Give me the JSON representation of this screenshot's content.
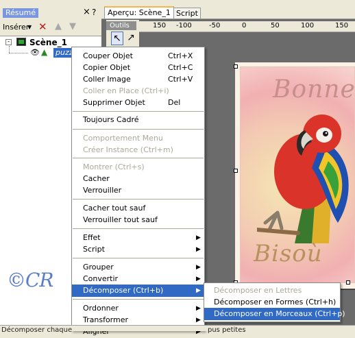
{
  "left_panel": {
    "title": "Résumé",
    "close_glyph": "×",
    "help_glyph": "?",
    "toolbar": {
      "insert_label": "Insérer",
      "insert_caret": "▼",
      "delete_icon": "✕",
      "up_icon": "▲",
      "down_icon": "▼"
    },
    "tree": {
      "expander": "-",
      "scene_label": "Scène_1",
      "object_label": "puzzle",
      "eye_icon": "👁",
      "shape_icon": "▲"
    },
    "watermark": "©CR"
  },
  "tabs": [
    {
      "label": "Aperçu: Scène_1",
      "active": true
    },
    {
      "label": "Script",
      "active": false
    }
  ],
  "outils": {
    "title": "Outils",
    "arrow_tool_glyph": "↖",
    "node_tool_glyph": "↗"
  },
  "ruler": {
    "ticks": [
      "150",
      "-100",
      "-50",
      "0",
      "50",
      "100",
      "150"
    ]
  },
  "canvas": {
    "text_top": "Bonne",
    "text_bottom": "Bisoù"
  },
  "context_menu": {
    "items": [
      {
        "label": "Couper Objet",
        "shortcut": "Ctrl+X",
        "disabled": false
      },
      {
        "label": "Copier Objet",
        "shortcut": "Ctrl+C",
        "disabled": false
      },
      {
        "label": "Coller Image",
        "shortcut": "Ctrl+V",
        "disabled": false
      },
      {
        "label": "Coller en Place (Ctrl+i)",
        "shortcut": "",
        "disabled": true
      },
      {
        "label": "Supprimer Objet",
        "shortcut": "Del",
        "disabled": false
      },
      {
        "label": "Toujours Cadré",
        "shortcut": "",
        "disabled": false
      },
      {
        "label": "Comportement Menu",
        "shortcut": "",
        "disabled": true
      },
      {
        "label": "Créer Instance (Ctrl+m)",
        "shortcut": "",
        "disabled": true
      },
      {
        "label": "Montrer (Ctrl+s)",
        "shortcut": "",
        "disabled": true
      },
      {
        "label": "Cacher",
        "shortcut": "",
        "disabled": false
      },
      {
        "label": "Verrouiller",
        "shortcut": "",
        "disabled": false
      },
      {
        "label": "Cacher tout sauf",
        "shortcut": "",
        "disabled": false
      },
      {
        "label": "Verrouiller tout sauf",
        "shortcut": "",
        "disabled": false
      },
      {
        "label": "Effet",
        "shortcut": "",
        "submenu": true
      },
      {
        "label": "Script",
        "shortcut": "",
        "submenu": true
      },
      {
        "label": "Grouper",
        "shortcut": "",
        "submenu": true
      },
      {
        "label": "Convertir",
        "shortcut": "",
        "submenu": true
      },
      {
        "label": "Décomposer (Ctrl+b)",
        "shortcut": "",
        "submenu": true,
        "highlighted": true
      },
      {
        "label": "Ordonner",
        "shortcut": "",
        "submenu": true
      },
      {
        "label": "Transformer",
        "shortcut": "",
        "submenu": true
      },
      {
        "label": "Aligner",
        "shortcut": "",
        "submenu": true
      }
    ],
    "submenu_arrow": "▶"
  },
  "submenu": {
    "items": [
      {
        "label": "Décomposer en Lettres",
        "disabled": true
      },
      {
        "label": "Décomposer en Formes  (Ctrl+h)",
        "disabled": false
      },
      {
        "label": "Décomposer en Morceaux (Ctrl+p)",
        "disabled": false,
        "highlighted": true
      }
    ]
  },
  "status_bar": {
    "left_text": "Décomposer chaque",
    "right_text": "pus petites"
  },
  "colors": {
    "menu_highlight": "#316ac5",
    "disabled_text": "#aca899",
    "workspace": "#6b6b6b",
    "watermark": "#5b7ec7"
  }
}
